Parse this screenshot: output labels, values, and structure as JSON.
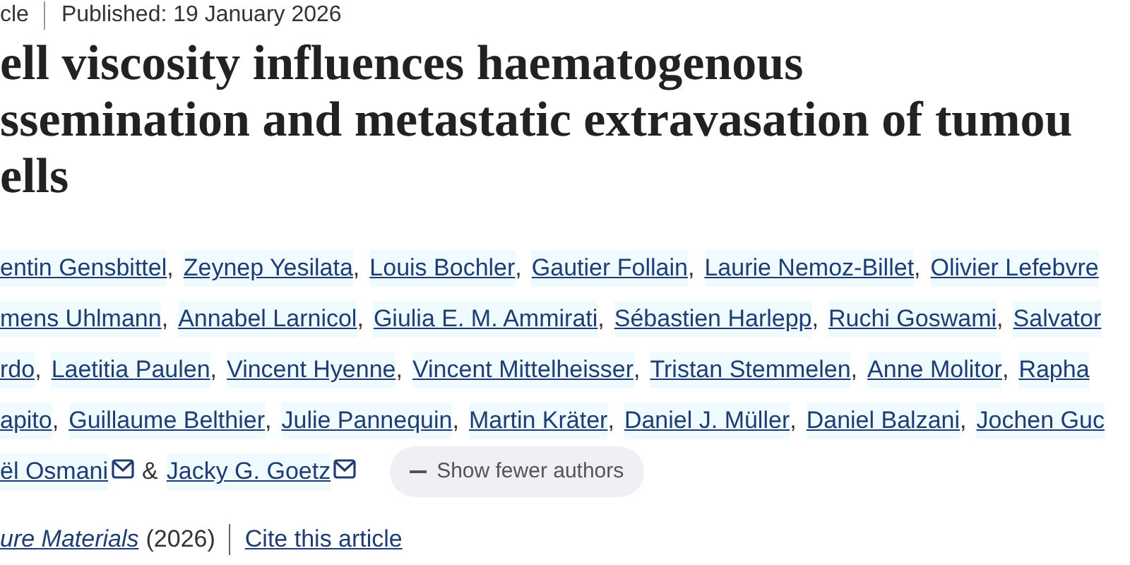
{
  "header": {
    "article_type": "cle",
    "published": "Published: 19 January 2026"
  },
  "title_lines": [
    "ell viscosity influences haematogenous",
    "ssemination and metastatic extravasation of tumou",
    "ells"
  ],
  "author_lines": [
    [
      {
        "name": "entin Gensbittel",
        "sep": ","
      },
      {
        "name": "Zeynep Yesilata",
        "sep": ","
      },
      {
        "name": "Louis Bochler",
        "sep": ","
      },
      {
        "name": "Gautier Follain",
        "sep": ","
      },
      {
        "name": "Laurie Nemoz-Billet",
        "sep": ","
      },
      {
        "name": "Olivier Lefebvre"
      }
    ],
    [
      {
        "name": "mens Uhlmann",
        "sep": ","
      },
      {
        "name": "Annabel Larnicol",
        "sep": ","
      },
      {
        "name": "Giulia E. M. Ammirati",
        "sep": ","
      },
      {
        "name": "Sébastien Harlepp",
        "sep": ","
      },
      {
        "name": "Ruchi Goswami",
        "sep": ","
      },
      {
        "name": "Salvator"
      }
    ],
    [
      {
        "name": "rdo",
        "sep": ","
      },
      {
        "name": "Laetitia Paulen",
        "sep": ","
      },
      {
        "name": "Vincent Hyenne",
        "sep": ","
      },
      {
        "name": "Vincent Mittelheisser",
        "sep": ","
      },
      {
        "name": "Tristan Stemmelen",
        "sep": ","
      },
      {
        "name": "Anne Molitor",
        "sep": ","
      },
      {
        "name": "Rapha"
      }
    ],
    [
      {
        "name": "apito",
        "sep": ","
      },
      {
        "name": "Guillaume Belthier",
        "sep": ","
      },
      {
        "name": "Julie Pannequin",
        "sep": ","
      },
      {
        "name": "Martin Kräter",
        "sep": ","
      },
      {
        "name": "Daniel J. Müller",
        "sep": ","
      },
      {
        "name": "Daniel Balzani",
        "sep": ","
      },
      {
        "name": "Jochen Guc"
      }
    ],
    [
      {
        "name": "ël Osmani",
        "email": true,
        "sep": "&"
      },
      {
        "name": "Jacky G. Goetz",
        "email": true
      }
    ]
  ],
  "toggle_button": {
    "label": "Show fewer authors"
  },
  "footer": {
    "journal": "ure Materials",
    "year": "(2026)",
    "cite": "Cite this article"
  }
}
